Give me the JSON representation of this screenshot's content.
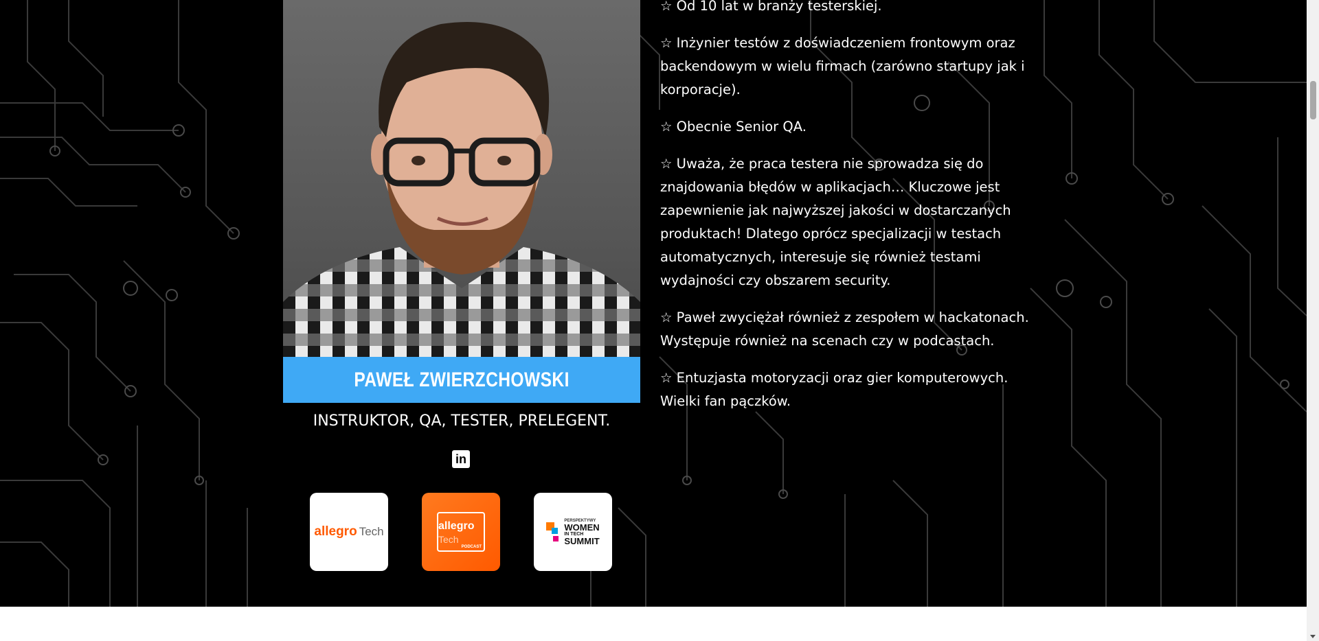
{
  "speaker": {
    "name": "PAWEŁ ZWIERZCHOWSKI",
    "roles": "INSTRUKTOR, QA, TESTER, PRELEGENT.",
    "linkedin_icon": "linkedin-icon",
    "linkedin_glyph": "in"
  },
  "bio": {
    "paragraphs": [
      "☆ Od 10 lat w branży testerskiej.",
      "☆ Inżynier testów z doświadczeniem frontowym oraz backendowym w wielu firmach (zarówno startupy jak i korporacje).",
      "☆ Obecnie Senior QA.",
      "☆ Uważa, że praca testera nie sprowadza się do znajdowania błędów w aplikacjach… Kluczowe jest zapewnienie jak najwyższej jakości w dostarczanych produktach! Dlatego oprócz specjalizacji w testach automatycznych, interesuje się również testami wydajności czy obszarem security.",
      "☆ Paweł zwyciężał również z zespołem w hackatonach. Występuje również na scenach czy w podcastach.",
      "☆ Entuzjasta motoryzacji oraz gier komputerowych. Wielki fan pączków."
    ]
  },
  "logos": {
    "allegro": {
      "word": "allegro",
      "suffix": "Tech"
    },
    "podcast": {
      "word": "allegro",
      "suffix": "Tech",
      "label": "PODCAST"
    },
    "women": {
      "line0": "PERSPEKTYWY",
      "line1": "WOMEN",
      "line2": "IN TECH",
      "line3": "SUMMIT"
    }
  },
  "colors": {
    "name_bar": "#3fa9f5",
    "background": "#000000",
    "allegro_orange": "#ff5a00"
  }
}
